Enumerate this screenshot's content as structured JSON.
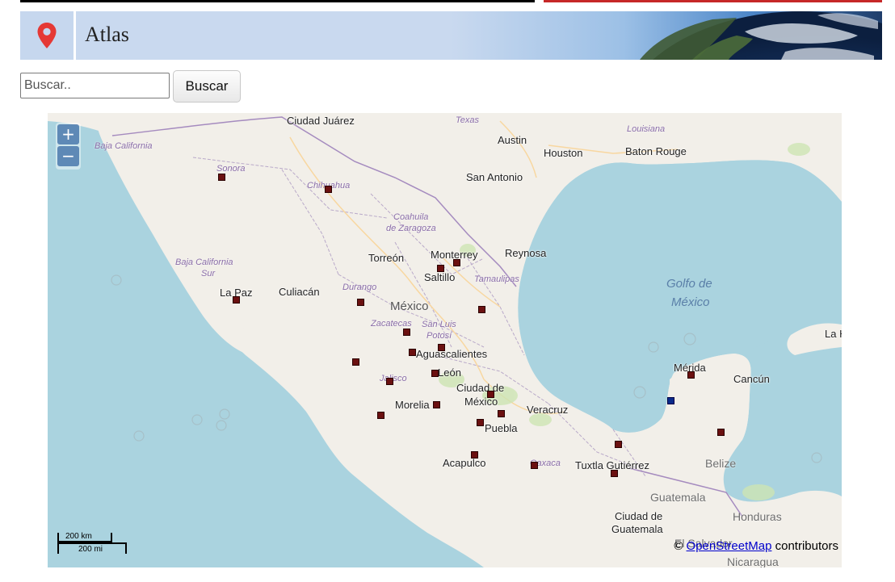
{
  "header": {
    "title": "Atlas",
    "icon": "map-pin-icon",
    "accent": "#e53935"
  },
  "search": {
    "placeholder": "Buscar..",
    "value": "",
    "button_label": "Buscar"
  },
  "map": {
    "zoom_in": "+",
    "zoom_out": "−",
    "scale_km": "200 km",
    "scale_mi": "200 mi",
    "attribution_prefix": "©",
    "attribution_link": "OpenStreetMap",
    "attribution_suffix": "contributors",
    "labels": [
      {
        "id": "ciudad-juarez",
        "text": "Ciudad Juárez",
        "kind": "city"
      },
      {
        "id": "texas",
        "text": "Texas",
        "kind": "state"
      },
      {
        "id": "louisiana",
        "text": "Louisiana",
        "kind": "state"
      },
      {
        "id": "austin",
        "text": "Austin",
        "kind": "city"
      },
      {
        "id": "houston",
        "text": "Houston",
        "kind": "city"
      },
      {
        "id": "baton-rouge",
        "text": "Baton Rouge",
        "kind": "city"
      },
      {
        "id": "baja-california",
        "text": "Baja California",
        "kind": "state"
      },
      {
        "id": "sonora",
        "text": "Sonora",
        "kind": "state"
      },
      {
        "id": "chihuahua",
        "text": "Chihuahua",
        "kind": "state"
      },
      {
        "id": "san-antonio",
        "text": "San Antonio",
        "kind": "city"
      },
      {
        "id": "coahuila-1",
        "text": "Coahuila",
        "kind": "state"
      },
      {
        "id": "coahuila-2",
        "text": "de Zaragoza",
        "kind": "state"
      },
      {
        "id": "torreon",
        "text": "Torreón",
        "kind": "city"
      },
      {
        "id": "monterrey",
        "text": "Monterrey",
        "kind": "city"
      },
      {
        "id": "reynosa",
        "text": "Reynosa",
        "kind": "city"
      },
      {
        "id": "baja-california-sur-1",
        "text": "Baja California",
        "kind": "state"
      },
      {
        "id": "baja-california-sur-2",
        "text": "Sur",
        "kind": "state"
      },
      {
        "id": "saltillo",
        "text": "Saltillo",
        "kind": "city"
      },
      {
        "id": "tamaulipas",
        "text": "Tamaulipas",
        "kind": "state"
      },
      {
        "id": "golfo-1",
        "text": "Golfo de",
        "kind": "sea"
      },
      {
        "id": "golfo-2",
        "text": "México",
        "kind": "sea"
      },
      {
        "id": "la-paz",
        "text": "La Paz",
        "kind": "city"
      },
      {
        "id": "culiacan",
        "text": "Culiacán",
        "kind": "city"
      },
      {
        "id": "durango",
        "text": "Durango",
        "kind": "state"
      },
      {
        "id": "mexico",
        "text": "México",
        "kind": "country-big"
      },
      {
        "id": "zacatecas",
        "text": "Zacatecas",
        "kind": "state"
      },
      {
        "id": "san-luis-1",
        "text": "San Luis",
        "kind": "state"
      },
      {
        "id": "san-luis-2",
        "text": "Potosí",
        "kind": "state"
      },
      {
        "id": "aguascalientes",
        "text": "Aguascalientes",
        "kind": "city"
      },
      {
        "id": "la-habana",
        "text": "La H",
        "kind": "city"
      },
      {
        "id": "merida",
        "text": "Mérida",
        "kind": "city"
      },
      {
        "id": "cancun",
        "text": "Cancún",
        "kind": "city"
      },
      {
        "id": "jalisco",
        "text": "Jalisco",
        "kind": "state"
      },
      {
        "id": "leon",
        "text": "León",
        "kind": "city"
      },
      {
        "id": "ciudad-de-mexico-1",
        "text": "Ciudad de",
        "kind": "city"
      },
      {
        "id": "ciudad-de-mexico-2",
        "text": "México",
        "kind": "city"
      },
      {
        "id": "morelia",
        "text": "Morelia",
        "kind": "city"
      },
      {
        "id": "veracruz",
        "text": "Veracruz",
        "kind": "city"
      },
      {
        "id": "puebla",
        "text": "Puebla",
        "kind": "city"
      },
      {
        "id": "acapulco",
        "text": "Acapulco",
        "kind": "city"
      },
      {
        "id": "oaxaca",
        "text": "Oaxaca",
        "kind": "state"
      },
      {
        "id": "tuxtla",
        "text": "Tuxtla Gutiérrez",
        "kind": "city"
      },
      {
        "id": "belize",
        "text": "Belize",
        "kind": "country"
      },
      {
        "id": "guatemala",
        "text": "Guatemala",
        "kind": "country"
      },
      {
        "id": "ciudad-guatemala-1",
        "text": "Ciudad de",
        "kind": "city"
      },
      {
        "id": "ciudad-guatemala-2",
        "text": "Guatemala",
        "kind": "city"
      },
      {
        "id": "honduras",
        "text": "Honduras",
        "kind": "country"
      },
      {
        "id": "el-salvador",
        "text": "El Salvador",
        "kind": "country"
      },
      {
        "id": "nicaragua",
        "text": "Nicaragua",
        "kind": "country"
      }
    ],
    "marker_color": "#6b1010",
    "highlight_marker_color": "#0a2a8a"
  }
}
